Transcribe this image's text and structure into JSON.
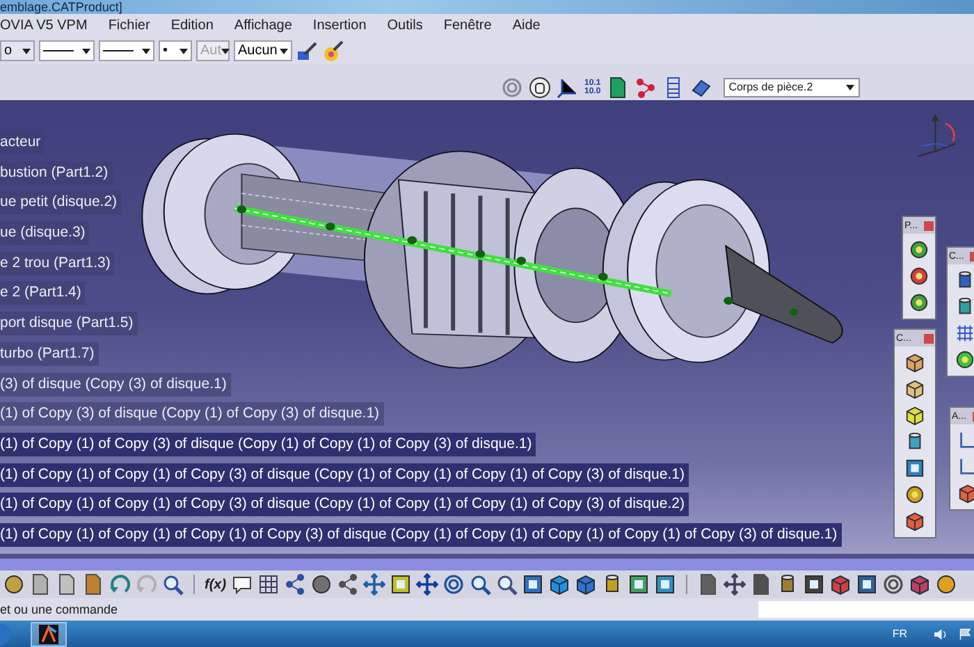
{
  "window": {
    "title": "emblage.CATProduct]"
  },
  "menu": [
    "OVIA V5 VPM",
    "Fichier",
    "Edition",
    "Affichage",
    "Insertion",
    "Outils",
    "Fenêtre",
    "Aide"
  ],
  "graphic_toolbar": {
    "combos": [
      {
        "kind": "text",
        "value": "o",
        "disabled": false
      },
      {
        "kind": "line",
        "disabled": false
      },
      {
        "kind": "line",
        "disabled": false
      },
      {
        "kind": "text",
        "value": "•",
        "disabled": false
      },
      {
        "kind": "text",
        "value": "Aut",
        "disabled": true
      },
      {
        "kind": "text",
        "value": "Aucun",
        "disabled": false
      }
    ]
  },
  "tools_toolbar": {
    "units_label": [
      "10.1",
      "10.0"
    ],
    "body_select": "Corps de pièce.2"
  },
  "tree": [
    {
      "label": "acteur",
      "selected": false
    },
    {
      "label": "bustion  (Part1.2)",
      "selected": false
    },
    {
      "label": "ue petit (disque.2)",
      "selected": false
    },
    {
      "label": "ue (disque.3)",
      "selected": false
    },
    {
      "label": "e 2 trou (Part1.3)",
      "selected": false
    },
    {
      "label": "e 2 (Part1.4)",
      "selected": false
    },
    {
      "label": "port disque (Part1.5)",
      "selected": false
    },
    {
      "label": "turbo (Part1.7)",
      "selected": false
    },
    {
      "label": "(3) of disque (Copy (3) of disque.1)",
      "selected": false
    },
    {
      "label": "(1) of Copy (3) of disque (Copy (1) of Copy (3) of disque.1)",
      "selected": false
    },
    {
      "label": "(1) of Copy (1) of Copy (3) of disque (Copy (1) of Copy (1) of Copy (3) of disque.1)",
      "selected": true
    },
    {
      "label": "(1) of Copy (1) of Copy (1) of Copy (3) of disque (Copy (1) of Copy (1) of Copy (1) of Copy (3) of disque.1)",
      "selected": true
    },
    {
      "label": "(1) of Copy (1) of Copy (1) of Copy (3) of disque (Copy (1) of Copy (1) of Copy (1) of Copy (3) of disque.2)",
      "selected": true
    },
    {
      "label": "(1) of Copy (1) of Copy (1) of Copy (1) of Copy (3) of disque (Copy (1) of Copy (1) of Copy (1) of Copy (1) of Copy (3) of disque.1)",
      "selected": true
    }
  ],
  "floating_toolbars": [
    {
      "title": "P..."
    },
    {
      "title": "C..."
    },
    {
      "title": "C..."
    },
    {
      "title": "A..."
    }
  ],
  "bottom_toolbar": {
    "formula_label": "f(x)"
  },
  "status_bar": {
    "prompt": "et ou une commande"
  },
  "taskbar": {
    "language": "FR"
  }
}
